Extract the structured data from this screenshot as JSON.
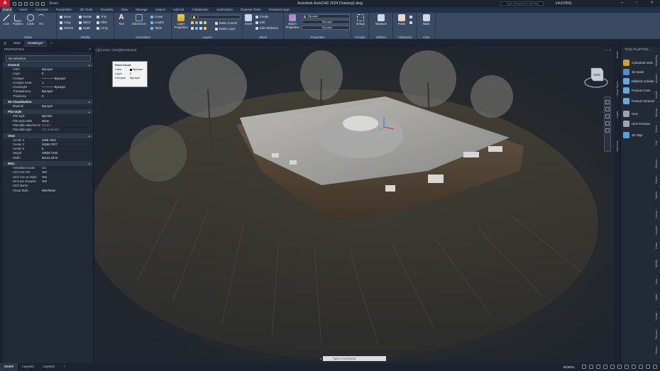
{
  "app": {
    "title": "Autodesk AutoCAD 2024   Drawing1.dwg",
    "logo_letter": "A",
    "share": "Share",
    "search_placeholder": "Type a keyword or phrase",
    "user": "info/OffXE",
    "accent_color": "#c4172c"
  },
  "ribbon": {
    "tabs": [
      "Home",
      "Insert",
      "Annotate",
      "Parametric",
      "3D Tools",
      "Visualize",
      "View",
      "Manage",
      "Output",
      "Add-ins",
      "Collaborate",
      "Automation",
      "Express Tools",
      "Featured Apps"
    ],
    "active_tab": "Home",
    "draw": {
      "label": "Draw",
      "line": "Line",
      "polyline": "Polyline",
      "circle": "Circle",
      "arc": "Arc"
    },
    "modify": {
      "label": "Modify",
      "move": "Move",
      "rotate": "Rotate",
      "trim": "Trim",
      "copy": "Copy",
      "mirror": "Mirror",
      "fillet": "Fillet",
      "stretch": "Stretch",
      "scale": "Scale",
      "array": "Array"
    },
    "annotation": {
      "label": "Annotation",
      "text": "Text",
      "dimension": "Dimension",
      "linear": "Linear",
      "leader": "Leader",
      "table": "Table"
    },
    "layers": {
      "label": "Layers",
      "layer_properties": "Layer Properties",
      "make_current": "Make Current",
      "match_layer": "Match Layer",
      "current_layer": "0"
    },
    "block": {
      "label": "Block",
      "insert": "Insert",
      "create": "Create",
      "edit": "Edit",
      "edit_attributes": "Edit Attributes"
    },
    "properties": {
      "label": "Properties",
      "match": "Match Properties",
      "color": "ByLayer",
      "linetype": "ByLayer",
      "lineweight": "ByLayer"
    },
    "groups": {
      "label": "Groups",
      "group": "Group"
    },
    "utilities": {
      "label": "Utilities",
      "measure": "Measure"
    },
    "clipboard": {
      "label": "Clipboard",
      "paste": "Paste"
    },
    "view": {
      "label": "View",
      "base": "Base"
    }
  },
  "doc_tabs": {
    "start": "Start",
    "drawing": "Drawing1*",
    "add": "+"
  },
  "properties_palette": {
    "title": "PROPERTIES",
    "selection": "No selection",
    "sections": [
      {
        "name": "General",
        "rows": [
          {
            "k": "Color",
            "v": "ByLayer"
          },
          {
            "k": "Layer",
            "v": "0"
          },
          {
            "k": "Linetype",
            "v": "———— ByLayer"
          },
          {
            "k": "Linetype scale",
            "v": "1"
          },
          {
            "k": "Lineweight",
            "v": "———— ByLayer"
          },
          {
            "k": "Transparency",
            "v": "ByLayer"
          },
          {
            "k": "Thickness",
            "v": "0"
          }
        ]
      },
      {
        "name": "3D Visualization",
        "rows": [
          {
            "k": "Material",
            "v": "ByLayer"
          }
        ]
      },
      {
        "name": "Plot style",
        "rows": [
          {
            "k": "Plot style",
            "v": "ByColor"
          },
          {
            "k": "Plot style table",
            "v": "None"
          },
          {
            "k": "Plot table attached to",
            "v": "Model"
          },
          {
            "k": "Plot table type",
            "v": "Not available"
          }
        ]
      },
      {
        "name": "View",
        "rows": [
          {
            "k": "Center X",
            "v": "4098.7654"
          },
          {
            "k": "Center Y",
            "v": "24260.7977"
          },
          {
            "k": "Center Z",
            "v": "0"
          },
          {
            "k": "Height",
            "v": "33826.7232"
          },
          {
            "k": "Width",
            "v": "60141.2473"
          }
        ]
      },
      {
        "name": "Misc",
        "rows": [
          {
            "k": "Annotation scale",
            "v": "1:1"
          },
          {
            "k": "UCS icon On",
            "v": "Yes"
          },
          {
            "k": "UCS icon at origin",
            "v": "Yes"
          },
          {
            "k": "UCS per viewport",
            "v": "Yes"
          },
          {
            "k": "UCS Name",
            "v": ""
          },
          {
            "k": "Visual Style",
            "v": "Wireframe"
          }
        ]
      }
    ]
  },
  "viewport": {
    "label": "[-][Custom View][Wireframe]",
    "controls": "– ▫ ×",
    "viewcube_face": "SIDE",
    "tooltip": {
      "title": "Point Cloud",
      "rows": [
        {
          "k": "Color",
          "v": "ByLayer"
        },
        {
          "k": "Layer",
          "v": "0"
        },
        {
          "k": "Linetype",
          "v": "ByLayer"
        }
      ]
    },
    "command_placeholder": "Type a command"
  },
  "tool_palettes": {
    "title": "TOOL PALETTES -...",
    "items": [
      {
        "label": "Cylindrical Helix",
        "color": "#c9a23a"
      },
      {
        "label": "3D Spiral",
        "color": "#4f8fd1"
      },
      {
        "label": "Elliptical Cylinder",
        "color": "#6aa9d8"
      },
      {
        "label": "Frustum Cone",
        "color": "#6aa9d8"
      },
      {
        "label": "Frustum Pyramid",
        "color": "#6aa9d8"
      },
      {
        "label": "UCS",
        "color": "#9aa4b3"
      },
      {
        "label": "UCS Previous",
        "color": "#9aa4b3"
      },
      {
        "label": "3D Align",
        "color": "#5f9fd8"
      }
    ],
    "side_tabs": [
      "Modeling",
      "Annota...",
      "Archit...",
      "Mecha...",
      "Electr...",
      "Civil",
      "Structu...",
      "Hatch...",
      "Tables",
      "Comm...",
      "Leaders",
      "Draw",
      "Modify",
      "Cam...",
      "Lights",
      "Visual...",
      "Params...",
      "Gener..."
    ],
    "strip_tabs": [
      "Model",
      "Visual Styles",
      "Lights",
      "Materials"
    ]
  },
  "status": {
    "tabs": [
      "Model",
      "Layout1",
      "Layout2"
    ],
    "active": "Model",
    "add": "+",
    "mode": "MODEL"
  }
}
